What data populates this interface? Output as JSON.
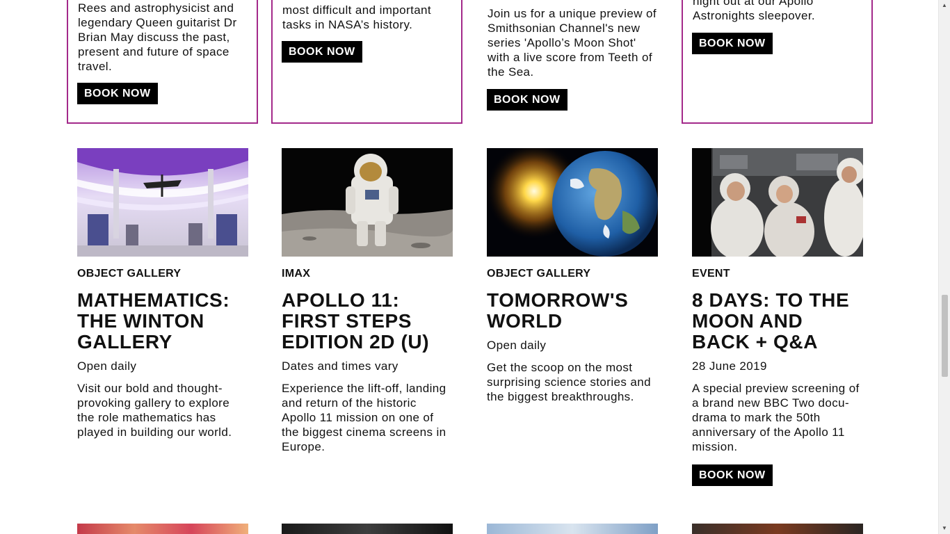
{
  "top_cards": [
    {
      "text": "Rees and astrophysicist and legendary Queen guitarist Dr Brian May discuss the past, present and future of space travel.",
      "button": "BOOK NOW",
      "border": true
    },
    {
      "text": "most difficult and important tasks in NASA’s history.",
      "button": "BOOK NOW",
      "border": true
    },
    {
      "text": "Join us for a unique preview of Smithsonian Channel's new series 'Apollo’s Moon Shot' with a live score from Teeth of the Sea.",
      "button": "BOOK NOW",
      "border": false
    },
    {
      "text": "night out at our Apollo Astronights sleepover.",
      "button": "BOOK NOW",
      "border": true
    }
  ],
  "cards": [
    {
      "category": "OBJECT GALLERY",
      "title": "MATHEMATICS: THE WINTON GALLERY",
      "date": "Open daily",
      "description": "Visit our bold and thought-provoking gallery to explore the role mathematics has played in building our world.",
      "image": "gallery-interior-photo"
    },
    {
      "category": "IMAX",
      "title": "APOLLO 11: FIRST STEPS EDITION 2D (U)",
      "date": "Dates and times vary",
      "description": "Experience the lift-off, landing and return of the historic Apollo 11 mission on one of the biggest cinema screens in Europe.",
      "image": "astronaut-on-moon-photo"
    },
    {
      "category": "OBJECT GALLERY",
      "title": "TOMORROW'S WORLD",
      "date": "Open daily",
      "description": "Get the scoop on the most surprising science stories and the biggest breakthroughs.",
      "image": "earth-from-space-photo"
    },
    {
      "category": "EVENT",
      "title": "8 DAYS: TO THE MOON AND BACK + Q&A",
      "date": "28 June 2019",
      "description": "A special preview screening of a brand new BBC Two docu-drama to mark the 50th anniversary of the Apollo 11 mission.",
      "button": "BOOK NOW",
      "image": "astronauts-in-capsule-photo"
    }
  ],
  "colors": {
    "accent_border": "#a3298a",
    "button_bg": "#000000",
    "button_text": "#ffffff"
  }
}
